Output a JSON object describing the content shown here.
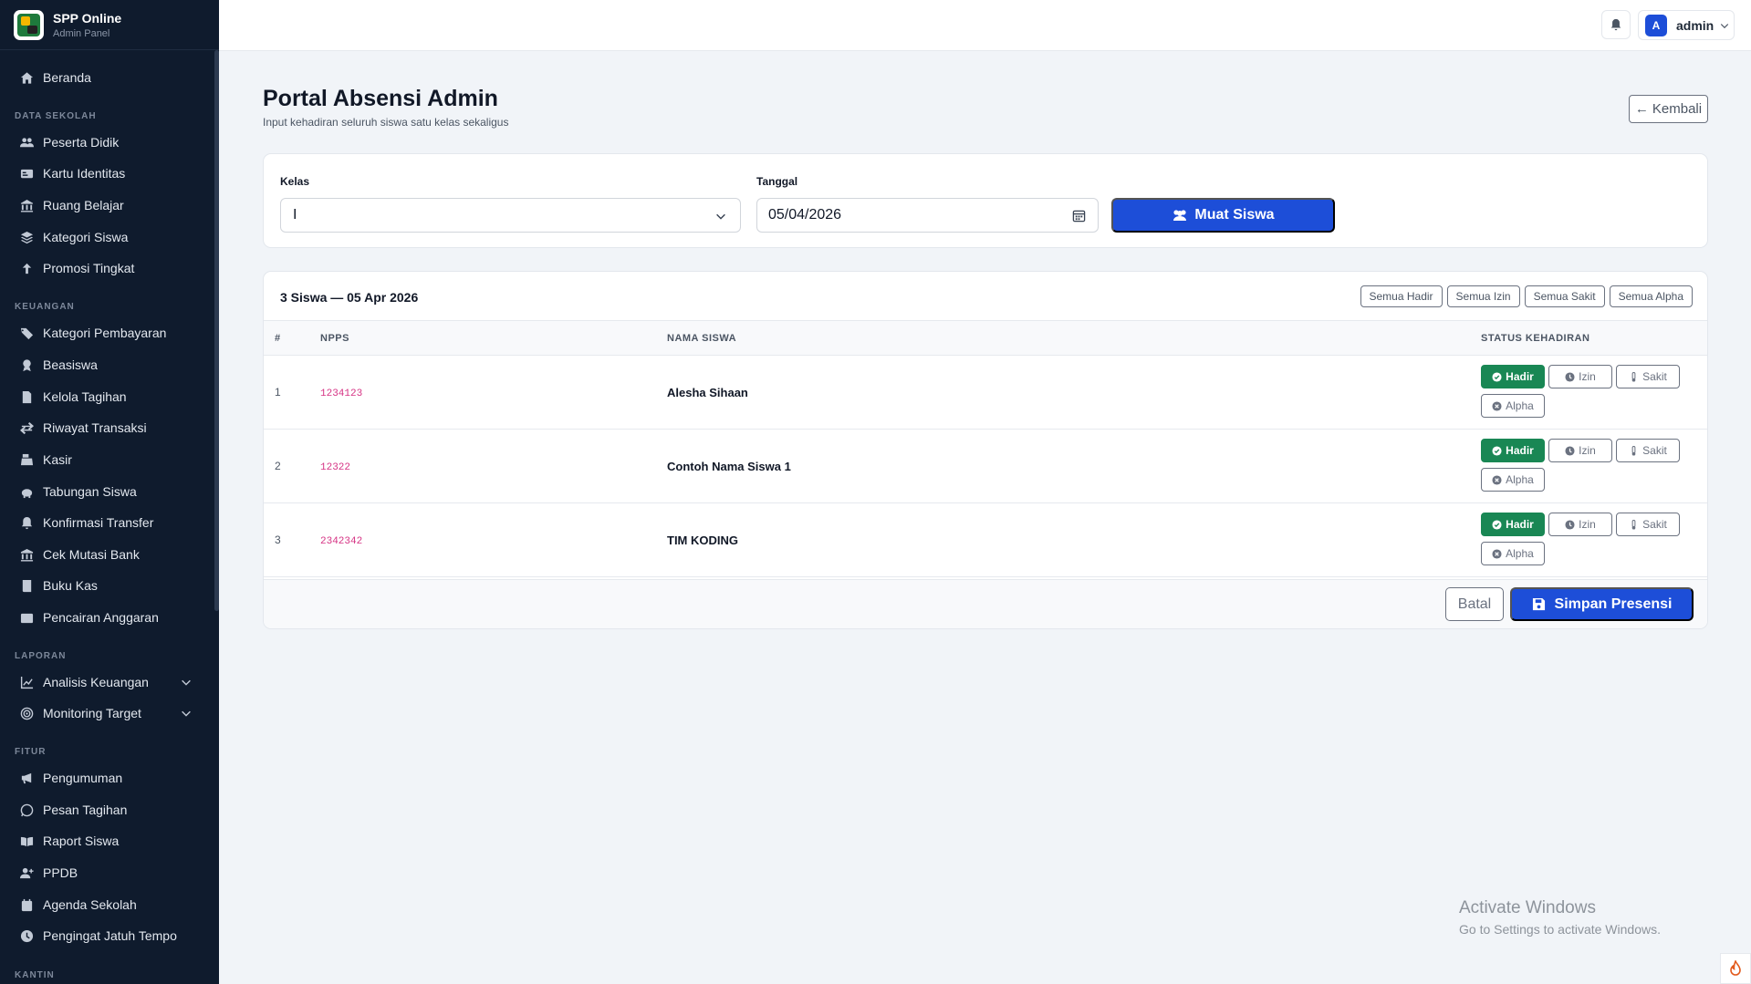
{
  "brand": {
    "title": "SPP Online",
    "subtitle": "Admin Panel"
  },
  "sidebar": {
    "home": "Beranda",
    "sections": {
      "data_sekolah": "DATA SEKOLAH",
      "keuangan": "KEUANGAN",
      "laporan": "LAPORAN",
      "fitur": "FITUR",
      "kantin": "KANTIN"
    },
    "data_sekolah_items": [
      "Peserta Didik",
      "Kartu Identitas",
      "Ruang Belajar",
      "Kategori Siswa",
      "Promosi Tingkat"
    ],
    "keuangan_items": [
      "Kategori Pembayaran",
      "Beasiswa",
      "Kelola Tagihan",
      "Riwayat Transaksi",
      "Kasir",
      "Tabungan Siswa",
      "Konfirmasi Transfer",
      "Cek Mutasi Bank",
      "Buku Kas",
      "Pencairan Anggaran"
    ],
    "laporan_items": [
      "Analisis Keuangan",
      "Monitoring Target"
    ],
    "fitur_items": [
      "Pengumuman",
      "Pesan Tagihan",
      "Raport Siswa",
      "PPDB",
      "Agenda Sekolah",
      "Pengingat Jatuh Tempo"
    ]
  },
  "topbar": {
    "avatar_letter": "A",
    "user_name": "admin"
  },
  "page": {
    "title": "Portal Absensi Admin",
    "subtitle": "Input kehadiran seluruh siswa satu kelas sekaligus",
    "back_label": "Kembali"
  },
  "filter": {
    "kelas_label": "Kelas",
    "kelas_value": "I",
    "tanggal_label": "Tanggal",
    "tanggal_value": "05/04/2026",
    "load_label": "Muat Siswa"
  },
  "table": {
    "summary": "3 Siswa — 05 Apr 2026",
    "bulk": [
      "Semua Hadir",
      "Semua Izin",
      "Semua Sakit",
      "Semua Alpha"
    ],
    "headers": {
      "num": "#",
      "npps": "NPPS",
      "name": "NAMA SISWA",
      "status": "STATUS KEHADIRAN"
    },
    "status_labels": {
      "hadir": "Hadir",
      "izin": "Izin",
      "sakit": "Sakit",
      "alpha": "Alpha"
    },
    "rows": [
      {
        "num": "1",
        "npps": "1234123",
        "name": "Alesha Sihaan",
        "status": "Hadir"
      },
      {
        "num": "2",
        "npps": "12322",
        "name": "Contoh Nama Siswa 1",
        "status": "Hadir"
      },
      {
        "num": "3",
        "npps": "2342342",
        "name": "TIM KODING",
        "status": "Hadir"
      }
    ],
    "cancel_label": "Batal",
    "save_label": "Simpan Presensi"
  },
  "watermark": {
    "title": "Activate Windows",
    "subtitle": "Go to Settings to activate Windows."
  },
  "colors": {
    "sidebar_bg": "#0f1b2d",
    "primary": "#1d4ed8",
    "success": "#198754",
    "npps": "#d63384"
  }
}
